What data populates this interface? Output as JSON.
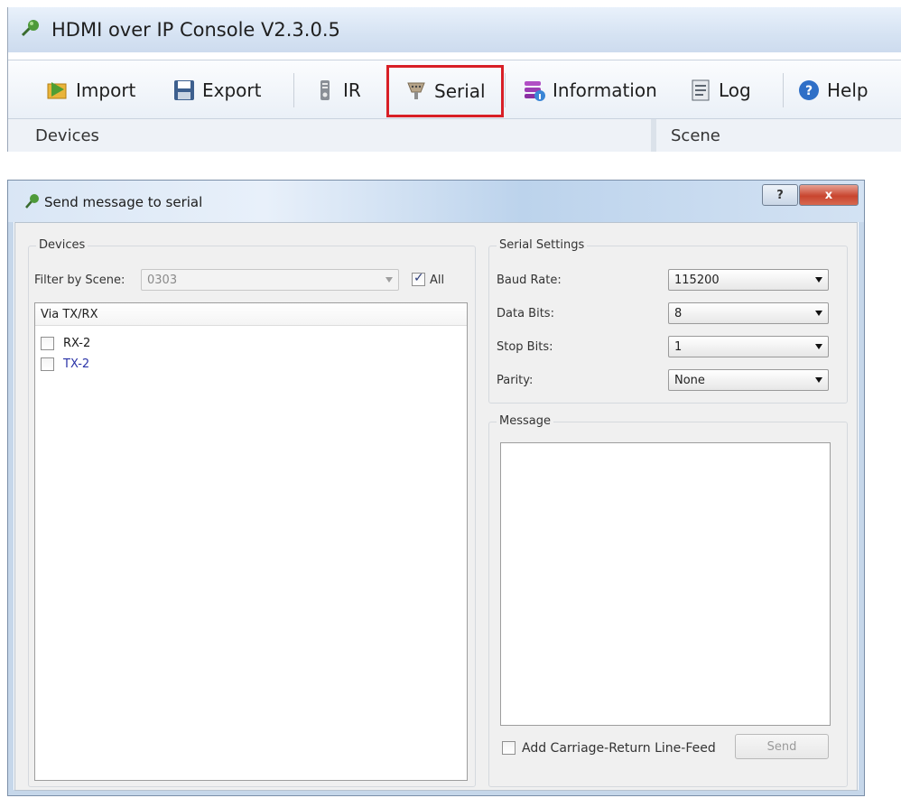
{
  "console": {
    "title": "HDMI over IP Console V2.3.0.5",
    "toolbar": [
      {
        "label": "Import",
        "icon": "import-icon"
      },
      {
        "label": "Export",
        "icon": "export-icon"
      },
      {
        "label": "IR",
        "icon": "ir-icon"
      },
      {
        "label": "Serial",
        "icon": "serial-icon",
        "highlighted": true
      },
      {
        "label": "Information",
        "icon": "information-icon"
      },
      {
        "label": "Log",
        "icon": "log-icon"
      },
      {
        "label": "Help",
        "icon": "help-icon"
      }
    ],
    "panels": {
      "devices": "Devices",
      "scene": "Scene"
    },
    "highlight_color": "#d81f26"
  },
  "dialog": {
    "title": "Send message to serial",
    "help_button": "?",
    "close_button": "x",
    "devices": {
      "group_title": "Devices",
      "filter_label": "Filter by Scene:",
      "filter_value": "0303",
      "all_label": "All",
      "all_checked": true,
      "list_header": "Via TX/RX",
      "items": [
        {
          "label": "RX-2",
          "checked": false
        },
        {
          "label": "TX-2",
          "checked": false
        }
      ]
    },
    "serial_settings": {
      "group_title": "Serial Settings",
      "baud_rate_label": "Baud Rate:",
      "baud_rate_value": "115200",
      "data_bits_label": "Data Bits:",
      "data_bits_value": "8",
      "stop_bits_label": "Stop Bits:",
      "stop_bits_value": "1",
      "parity_label": "Parity:",
      "parity_value": "None"
    },
    "message": {
      "group_title": "Message",
      "text": "",
      "crlf_label": "Add Carriage-Return Line-Feed",
      "crlf_checked": false,
      "send_label": "Send"
    }
  }
}
